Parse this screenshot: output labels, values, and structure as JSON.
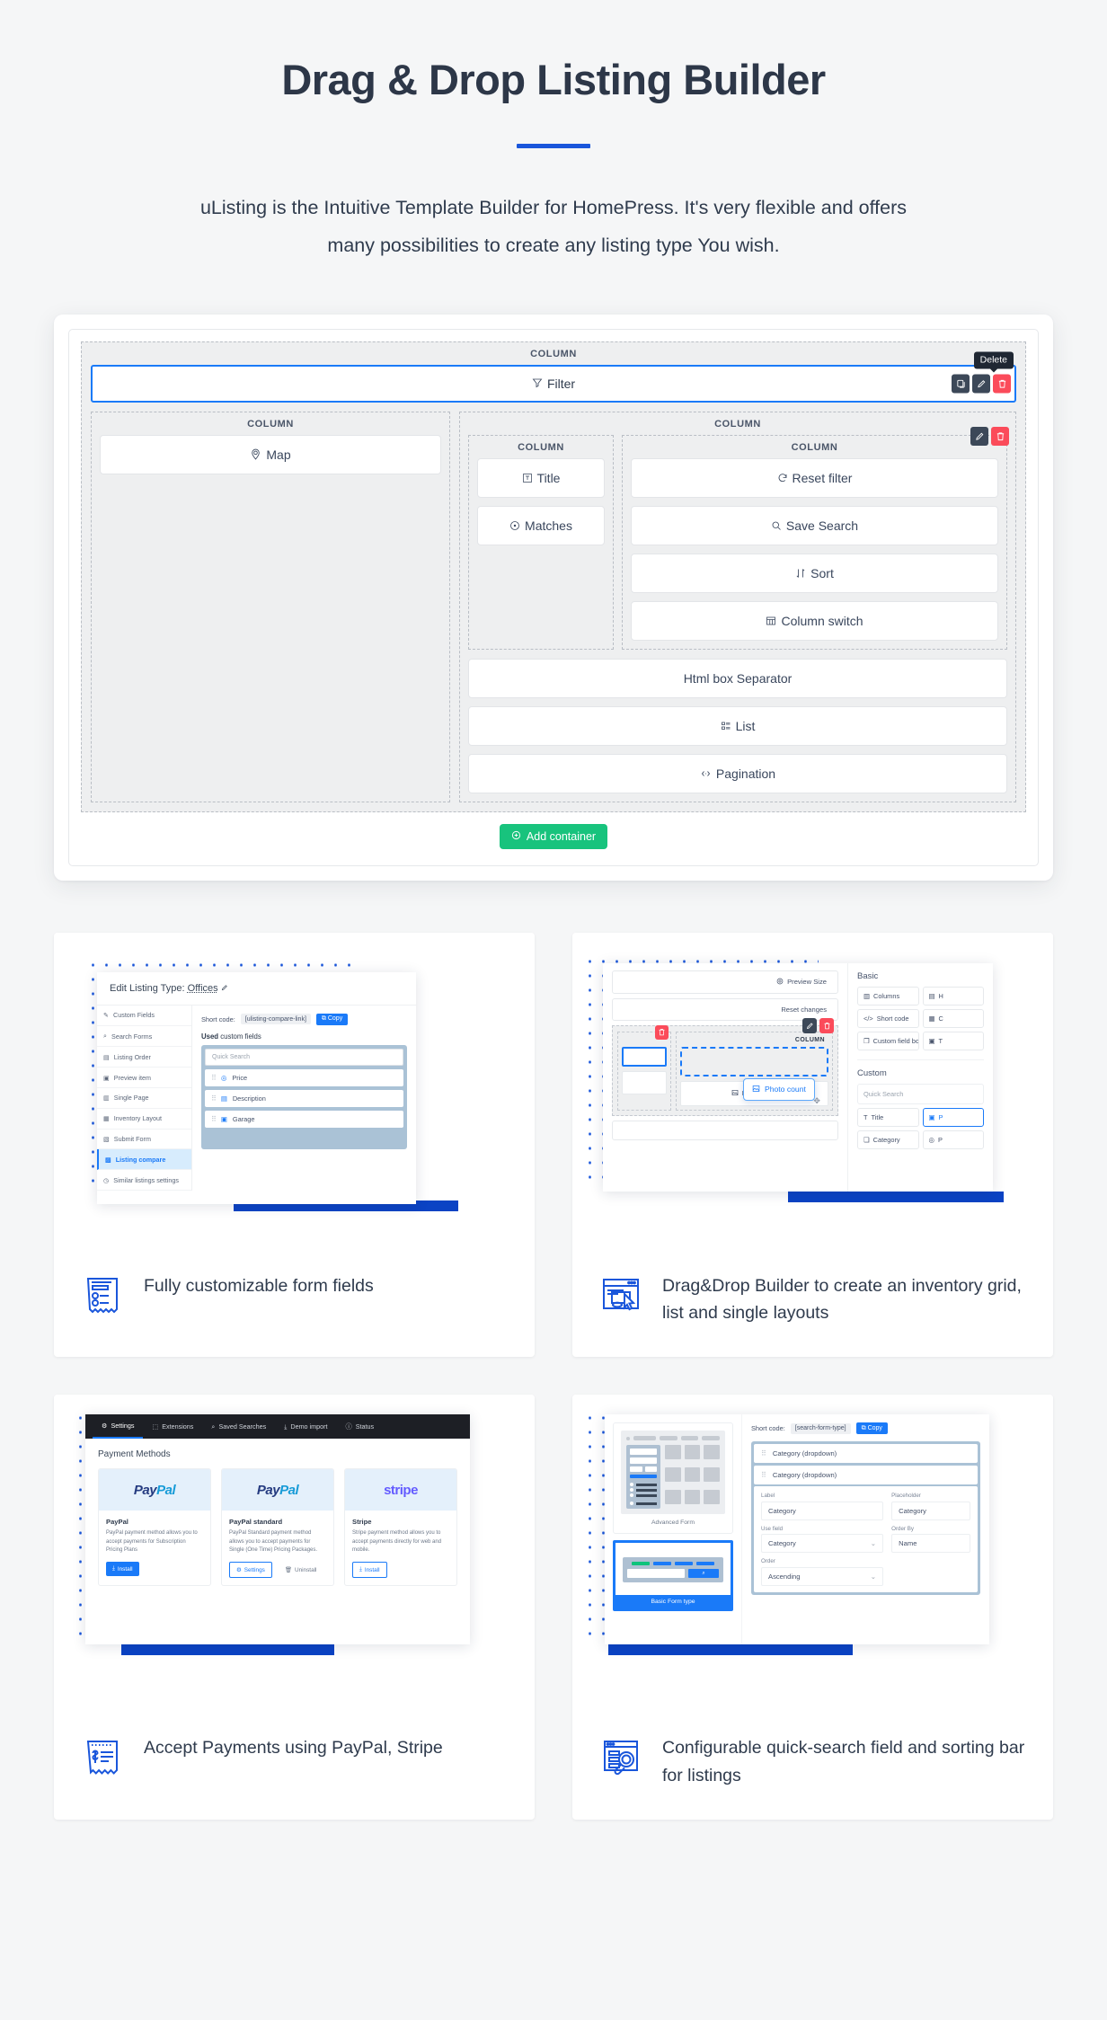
{
  "hero": {
    "title": "Drag & Drop Listing Builder",
    "lead": "uListing is the Intuitive Template Builder for HomePress. It's very flexible and offers many possibilities to create any listing type You wish.",
    "accent_color": "#1a56db"
  },
  "builder": {
    "column_label": "COLUMN",
    "tooltip_delete": "Delete",
    "top_widget": "Filter",
    "left_widget": "Map",
    "nested_left_widgets": [
      "Title",
      "Matches"
    ],
    "nested_right_widgets": [
      "Reset filter",
      "Save Search",
      "Sort",
      "Column switch"
    ],
    "bottom_widgets": [
      "Html box Separator",
      "List",
      "Pagination"
    ],
    "add_container_label": "Add container",
    "add_container_color": "#18c37d",
    "selected_border_color": "#1a7af8",
    "delete_button_color": "#fb4b5a",
    "edit_button_color": "#3c4858"
  },
  "cards": [
    {
      "caption": "Fully customizable form fields",
      "icon": "form-receipt-icon",
      "shot": {
        "title_prefix": "Edit Listing Type:",
        "title_value": "Offices",
        "nav": [
          "Custom Fields",
          "Search Forms",
          "Listing Order",
          "Preview item",
          "Single Page",
          "Inventory Layout",
          "Submit Form",
          "Listing compare",
          "Similar listings settings"
        ],
        "nav_active_index": 7,
        "shortcode_label": "Short code:",
        "shortcode_value": "[ulisting-compare-link]",
        "copy_label": "Copy",
        "section_strong": "Used",
        "section_rest": " custom fields",
        "quick_search_placeholder": "Quick Search",
        "fields": [
          "Price",
          "Description",
          "Garage"
        ]
      }
    },
    {
      "caption": "Drag&Drop Builder to create an inventory grid, list and single layouts",
      "icon": "drag-drop-cursor-icon",
      "shot": {
        "preview_size": "Preview Size",
        "reset_changes": "Reset changes",
        "column_label": "COLUMN",
        "drag_item": "Photo count",
        "dropped_item": "Photo count",
        "panel_basic_title": "Basic",
        "panel_basic_items": [
          "Columns",
          "H",
          "Short code",
          "C",
          "Custom field box",
          "T"
        ],
        "panel_custom_title": "Custom",
        "quick_search_placeholder": "Quick Search",
        "panel_custom_items": [
          "Title",
          "P",
          "Category",
          "P"
        ]
      }
    },
    {
      "caption": "Accept Payments using PayPal, Stripe",
      "icon": "payment-receipt-icon",
      "shot": {
        "tabs": [
          "Settings",
          "Extensions",
          "Saved Searches",
          "Demo import",
          "Status"
        ],
        "tab_active_index": 0,
        "section_title": "Payment Methods",
        "methods": [
          {
            "logo": "PayPal",
            "name": "PayPal",
            "desc": "PayPal payment method allows you to accept payments for Subscription Pricing Plans",
            "actions": [
              {
                "label": "Install",
                "style": "fill",
                "icon": "download-icon"
              }
            ]
          },
          {
            "logo": "PayPal",
            "name": "PayPal standard",
            "desc": "PayPal Standard payment method allows you to accept payments for Single (One Time) Pricing Packages.",
            "actions": [
              {
                "label": "Settings",
                "style": "out",
                "icon": "gear-icon"
              },
              {
                "label": "Uninstall",
                "style": "plain",
                "icon": "trash-icon"
              }
            ]
          },
          {
            "logo": "stripe",
            "name": "Stripe",
            "desc": "Stripe payment method allows you to accept payments directly for web and mobile.",
            "actions": [
              {
                "label": "Install",
                "style": "out",
                "icon": "download-icon"
              }
            ]
          }
        ]
      }
    },
    {
      "caption": "Configurable quick-search field and sorting bar for listings",
      "icon": "search-listings-icon",
      "shot": {
        "preview_advanced_label": "Advanced Form",
        "preview_basic_label": "Basic Form type",
        "shortcode_label": "Short code:",
        "shortcode_value": "[search-form-type]",
        "copy_label": "Copy",
        "rows": [
          "Category (dropdown)",
          "Category (dropdown)"
        ],
        "form": {
          "label_label": "Label",
          "label_value": "Category",
          "placeholder_label": "Placeholder",
          "placeholder_value": "Category",
          "usefield_label": "Use field",
          "usefield_value": "Category",
          "orderby_label": "Order By",
          "orderby_value": "Name",
          "order_label": "Order",
          "order_value": "Ascending"
        }
      }
    }
  ]
}
